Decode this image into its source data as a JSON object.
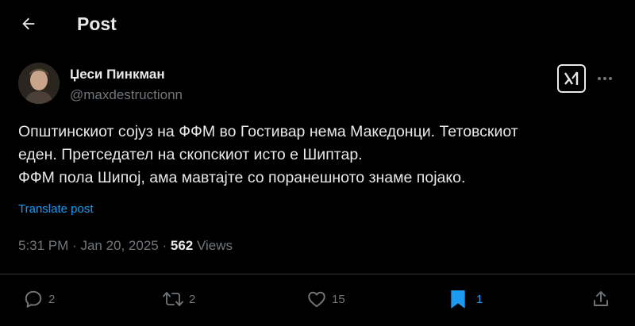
{
  "header": {
    "title": "Post"
  },
  "author": {
    "display_name": "Џеси Пинкман",
    "handle": "@maxdestructionn"
  },
  "post": {
    "lines": [
      "Општинскиот сојуз на ФФМ во Гостивар нема Македонци. Тетовскиот",
      "еден. Претседател на скопскиот исто е Шиптар.",
      "ФФМ пола Шипој, ама мавтајте со поранешното знаме појако."
    ],
    "translate_label": "Translate post"
  },
  "meta": {
    "time": "5:31 PM",
    "date": "Jan 20, 2025",
    "views_count": "562",
    "views_label": "Views"
  },
  "actions": {
    "replies": "2",
    "reposts": "2",
    "likes": "15",
    "bookmarks": "1"
  },
  "colors": {
    "background": "#000000",
    "text": "#e7e9ea",
    "muted": "#71767b",
    "accent": "#1d9bf0"
  },
  "icons": [
    "back-arrow-icon",
    "grok-icon",
    "more-icon",
    "reply-icon",
    "repost-icon",
    "like-icon",
    "bookmark-icon",
    "share-icon"
  ]
}
